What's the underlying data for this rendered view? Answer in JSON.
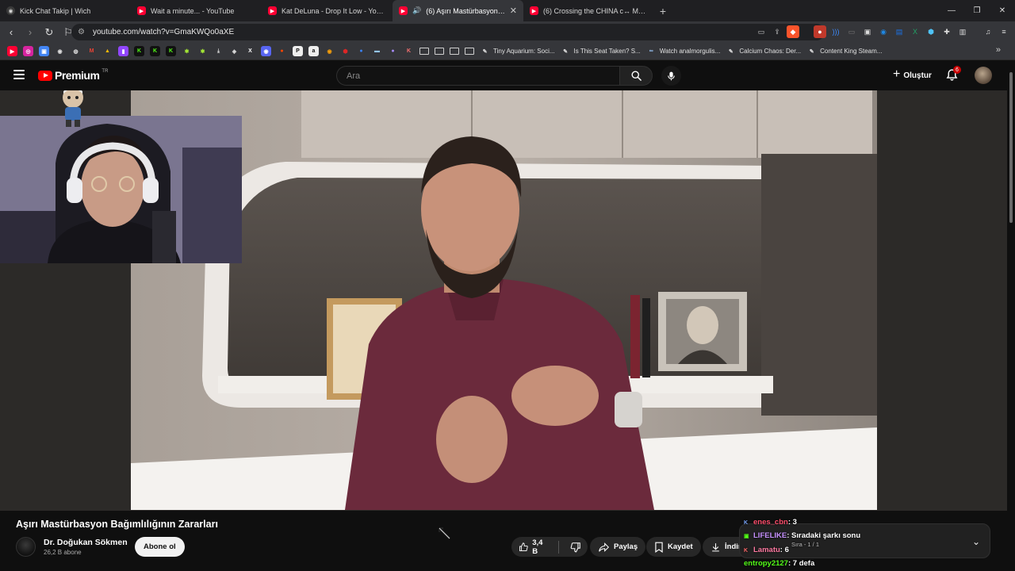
{
  "browser": {
    "tabs": [
      {
        "title": "Kick Chat Takip | Wich",
        "favicon": "kick-icon",
        "active": false
      },
      {
        "title": "Wait a minute... - YouTube",
        "favicon": "youtube-icon",
        "active": false
      },
      {
        "title": "Kat DeLuna - Drop It Low - YouTube",
        "favicon": "youtube-icon",
        "active": false
      },
      {
        "title": "(6) Aşırı Mastürbasyon Bağımlılığı",
        "favicon": "youtube-icon",
        "active": true,
        "playing_audio": true
      },
      {
        "title": "(6) Crossing the CHINA c↔ MONGOL",
        "favicon": "youtube-icon",
        "active": false
      }
    ],
    "url": "youtube.com/watch?v=GmaKWQo0aXE",
    "bookmarks": [
      {
        "label": "Tiny Aquarium: Soci...",
        "icon": "steam-icon"
      },
      {
        "label": "Is This Seat Taken? S...",
        "icon": "steam-icon"
      },
      {
        "label": "Watch analmorgulis...",
        "icon": "twitch-icon"
      },
      {
        "label": "Calcium Chaos: Der...",
        "icon": "steam-icon"
      },
      {
        "label": "Content King Steam...",
        "icon": "steam-icon"
      }
    ]
  },
  "youtube": {
    "logo_text": "Premium",
    "country_code": "TR",
    "search_placeholder": "Ara",
    "create_label": "Oluştur",
    "notification_count": "6"
  },
  "video": {
    "title": "Aşırı Mastürbasyon Bağımlılığının Zararları",
    "channel_name": "Dr. Doğukan Sökmen",
    "subscribers": "26,2 B abone",
    "subscribe_label": "Abone ol",
    "like_count": "3,4 B",
    "share_label": "Paylaş",
    "save_label": "Kaydet",
    "download_label": "İndir"
  },
  "chat_overlay": {
    "lines": [
      {
        "user": "enes_cbn",
        "text": ": 3",
        "color": "#ff4f6d"
      },
      {
        "user": "LIFELIKE",
        "text": ": Sıradaki şarkı sonu",
        "color": "#c792ff"
      },
      {
        "user": "Lamatu",
        "text": ": 6",
        "color": "#ff7aa2"
      },
      {
        "user": "entropy2127",
        "text": ": 7 defa",
        "color": "#53fc18"
      }
    ],
    "queue_line": "Sıra - 1 / 1"
  },
  "colors": {
    "page_bg": "#0f0f0f",
    "accent_red": "#ff0000",
    "kick_green": "#53fc18"
  }
}
